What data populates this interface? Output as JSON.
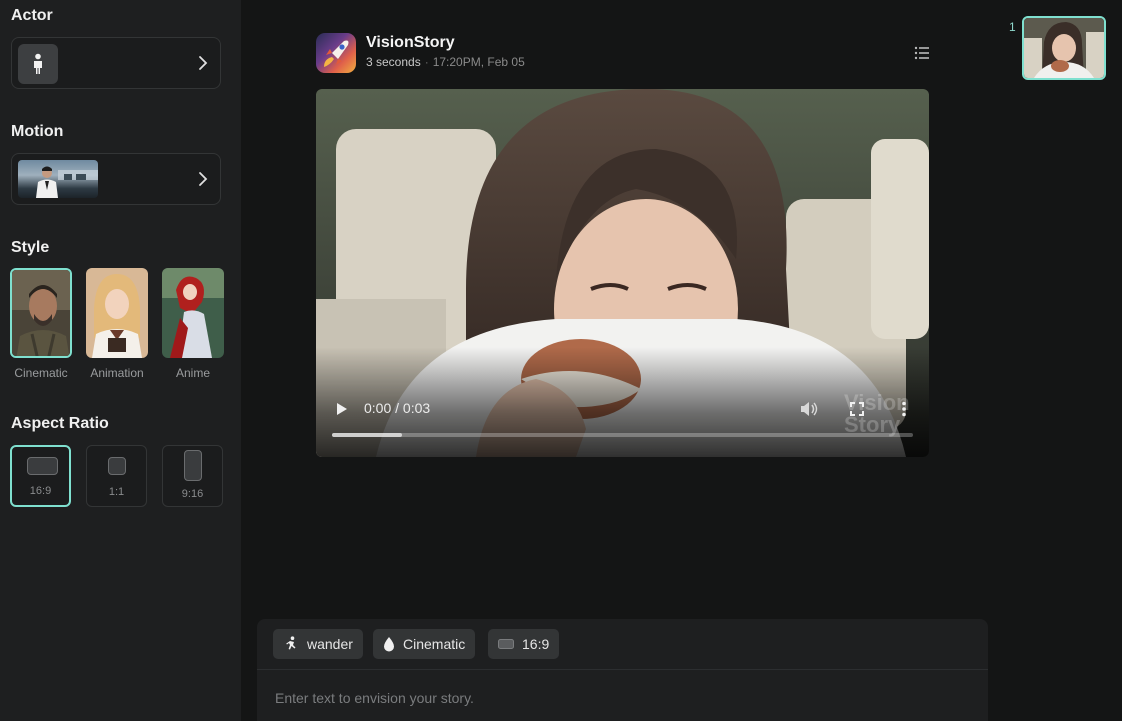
{
  "sidebar": {
    "actor": {
      "title": "Actor"
    },
    "motion": {
      "title": "Motion"
    },
    "style": {
      "title": "Style",
      "options": [
        {
          "label": "Cinematic",
          "selected": true
        },
        {
          "label": "Animation",
          "selected": false
        },
        {
          "label": "Anime",
          "selected": false
        }
      ]
    },
    "aspect_ratio": {
      "title": "Aspect Ratio",
      "options": [
        {
          "label": "16:9",
          "selected": true
        },
        {
          "label": "1:1",
          "selected": false
        },
        {
          "label": "9:16",
          "selected": false
        }
      ]
    }
  },
  "post": {
    "app_name": "VisionStory",
    "duration": "3 seconds",
    "separator": "·",
    "timestamp": "17:20PM, Feb 05"
  },
  "video": {
    "time_display": "0:00 / 0:03",
    "watermark": "Vision Story",
    "buffered_fraction": 0.12
  },
  "thumbnails": [
    {
      "index": "1",
      "selected": true
    }
  ],
  "composer": {
    "chips": [
      {
        "label": "wander",
        "icon": "running-person-icon"
      },
      {
        "label": "Cinematic",
        "icon": "droplet-icon"
      },
      {
        "label": "16:9",
        "icon": "aspect-ratio-icon"
      }
    ],
    "placeholder": "Enter text to envision your story."
  },
  "colors": {
    "accent": "#7fe0cf",
    "sidebar_bg": "#1e1f20",
    "page_bg": "#141515"
  }
}
